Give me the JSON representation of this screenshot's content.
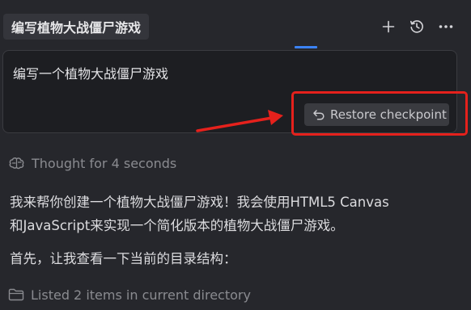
{
  "header": {
    "title": "编写植物大战僵尸游戏",
    "icons": [
      "plus-icon",
      "history-icon",
      "more-icon"
    ]
  },
  "message": {
    "text": "编写一个植物大战僵尸游戏",
    "restore_label": "Restore checkpoint",
    "restore_icon": "undo-icon"
  },
  "thought": {
    "icon": "brain-icon",
    "text": "Thought for 4 seconds"
  },
  "response": {
    "line1": "我来帮你创建一个植物大战僵尸游戏！我会使用HTML5 Canvas",
    "line2": "和JavaScript来实现一个简化版本的植物大战僵尸游戏。",
    "line3": "首先，让我查看一下当前的目录结构："
  },
  "tool": {
    "icon": "folder-icon",
    "text": "Listed 2 items in current directory"
  },
  "colors": {
    "background": "#26272c",
    "card": "#1d1e22",
    "accent": "#3b82f6",
    "annotation": "#e5211c"
  }
}
